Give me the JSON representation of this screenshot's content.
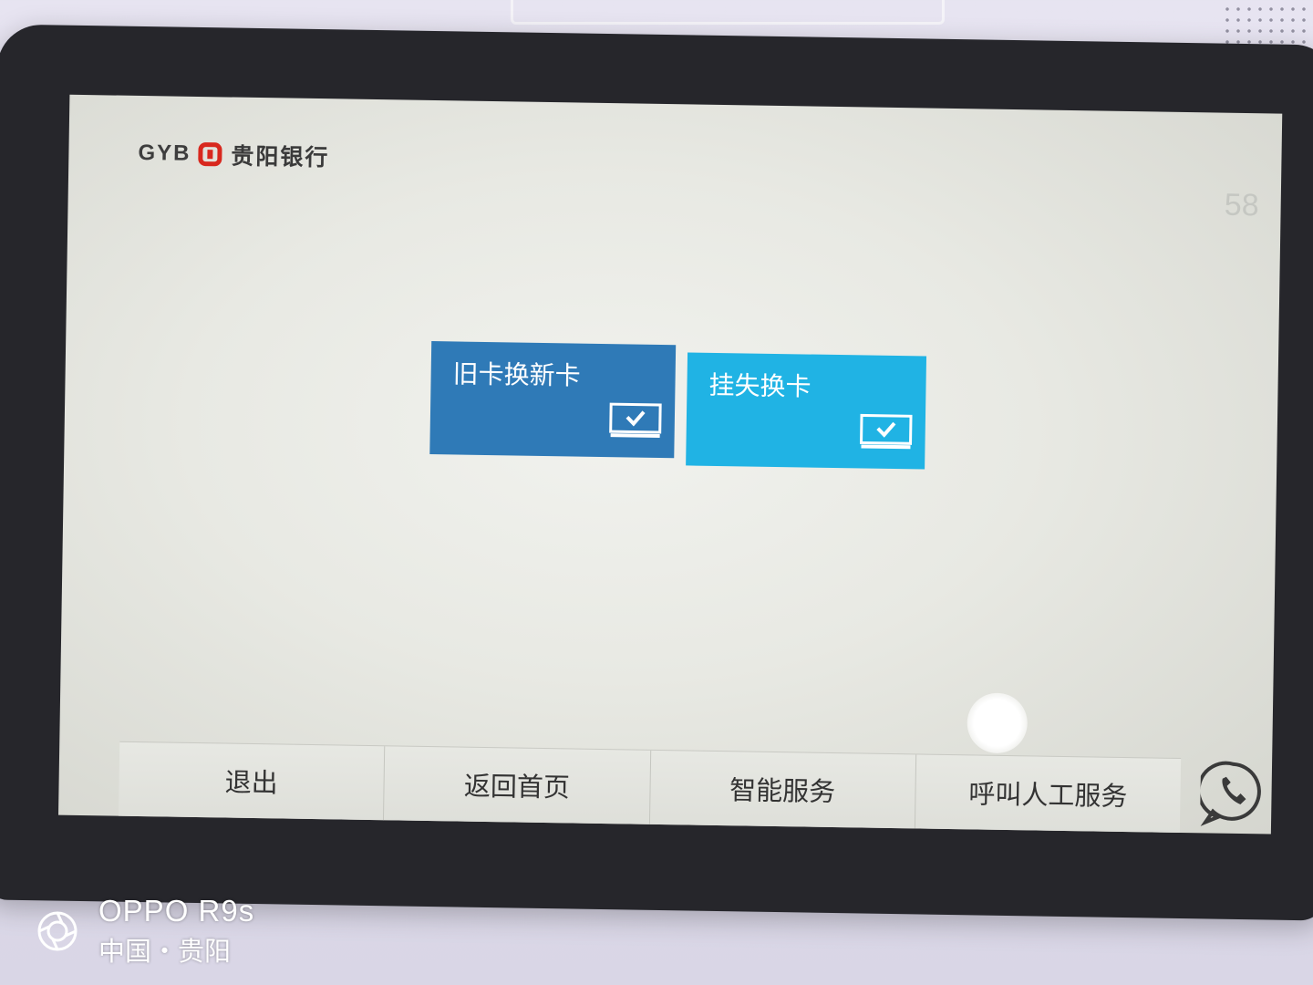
{
  "header": {
    "logo_abbr": "GYB",
    "logo_name": "贵阳银行",
    "countdown": "58"
  },
  "tiles": [
    {
      "label": "旧卡换新卡",
      "icon": "card-check-icon",
      "color": "#2f7ab7"
    },
    {
      "label": "挂失换卡",
      "icon": "card-check-icon",
      "color": "#20b3e4"
    }
  ],
  "bottom_nav": [
    {
      "label": "退出"
    },
    {
      "label": "返回首页"
    },
    {
      "label": "智能服务"
    },
    {
      "label": "呼叫人工服务"
    }
  ],
  "call_icon": "phone-chat-icon",
  "watermark": {
    "line1": "OPPO R9s",
    "line2": "中国・贵阳",
    "icon": "camera-shutter-icon"
  }
}
